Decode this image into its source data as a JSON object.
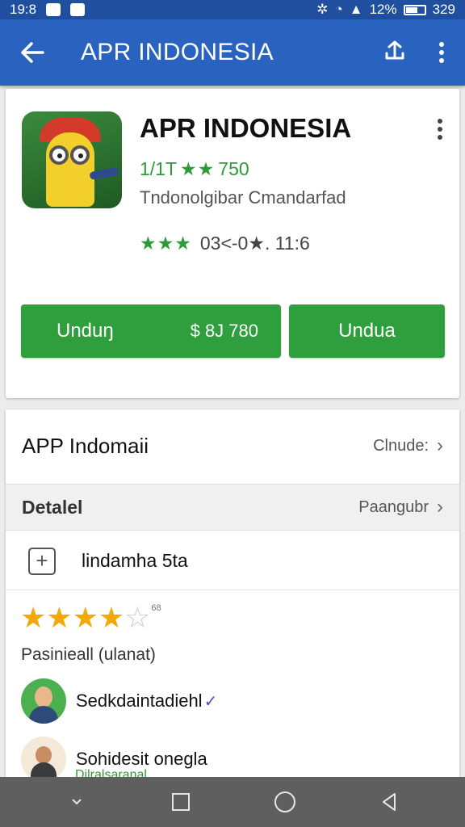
{
  "status_bar": {
    "time": "19:8",
    "battery_text": "12%",
    "clock_right": "329"
  },
  "app_bar": {
    "title": "APR INDONESIA",
    "back_icon": "arrow-left-icon",
    "share_icon": "share-icon",
    "menu_icon": "more-vert-icon"
  },
  "app_card": {
    "name": "APR INDONESIA",
    "rating_prefix": "1/1T",
    "rating_stars": "★★",
    "rating_value": "750",
    "developer": "Tndonolgibar Cmandarfad",
    "downloads_stars": "★★★",
    "downloads_text": "03<-0★. 11:6",
    "install_button": {
      "label": "Unduŋ",
      "price": "$ 8J 780"
    },
    "second_button": {
      "label": "Undua"
    }
  },
  "info_card": {
    "header": {
      "title": "APP Indomaii",
      "link": "Clnude:"
    },
    "detail": {
      "title": "Detalel",
      "link": "Paangubr"
    },
    "add_row": {
      "label": "lindamha 5ta"
    },
    "rating": {
      "filled": 4,
      "total": 5,
      "count": "68"
    },
    "review_caption": "Pasinieall (ulanat)",
    "reviewers": [
      {
        "name": "Sedkdaintadiehl",
        "mark": "✓"
      },
      {
        "name": "Sohidesit onegla",
        "mark": ""
      }
    ],
    "reviewer_sub": "Dilralsaranal"
  },
  "colors": {
    "status_bar": "#1f4f9e",
    "app_bar": "#2a62c0",
    "install_green": "#2f9e3c",
    "star_yellow": "#f3a90c",
    "nav_bar": "#5f5f5f"
  },
  "nav_bar": {
    "back": "nav-back-icon",
    "home": "nav-home-icon",
    "recents": "nav-recents-icon"
  }
}
